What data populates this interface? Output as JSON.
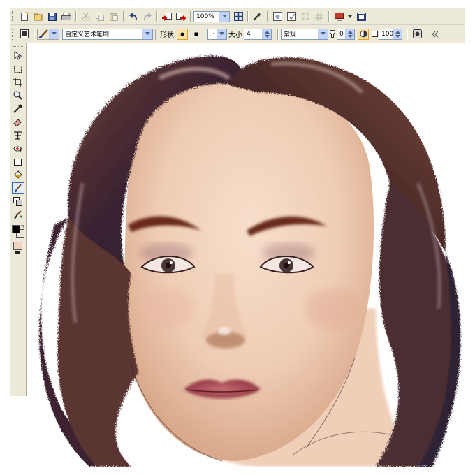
{
  "toolbar": {
    "zoom_value": "100%"
  },
  "property_bar": {
    "brush_preset": "自定义艺术笔刷",
    "shape_label": "形状",
    "size_label": "大小",
    "size_value": "4",
    "blend_mode": "常规",
    "transparency_value": "0",
    "opacity_value": "100"
  },
  "colors": {
    "foreground": "#000000",
    "background": "#ffffff",
    "paper": "#f0d2c0",
    "accent_active": "#316ac5"
  },
  "icons": {
    "toolbar": [
      "new-document-icon",
      "open-icon",
      "save-icon",
      "print-icon",
      "cut-icon",
      "copy-icon",
      "paste-icon",
      "undo-icon",
      "redo-icon",
      "import-icon",
      "export-icon",
      "zoom-fit-icon",
      "effects-icon",
      "restore-icon",
      "checkpoint-icon",
      "lens-icon",
      "grid-icon",
      "launcher-icon",
      "full-screen-icon"
    ],
    "tools": [
      "pick-tool-icon",
      "mask-tool-icon",
      "crop-tool-icon",
      "zoom-tool-icon",
      "eyedropper-tool-icon",
      "eraser-tool-icon",
      "text-tool-icon",
      "red-eye-tool-icon",
      "rectangle-tool-icon",
      "fill-tool-icon",
      "paint-tool-icon",
      "clone-tool-icon",
      "effect-tool-icon"
    ]
  }
}
